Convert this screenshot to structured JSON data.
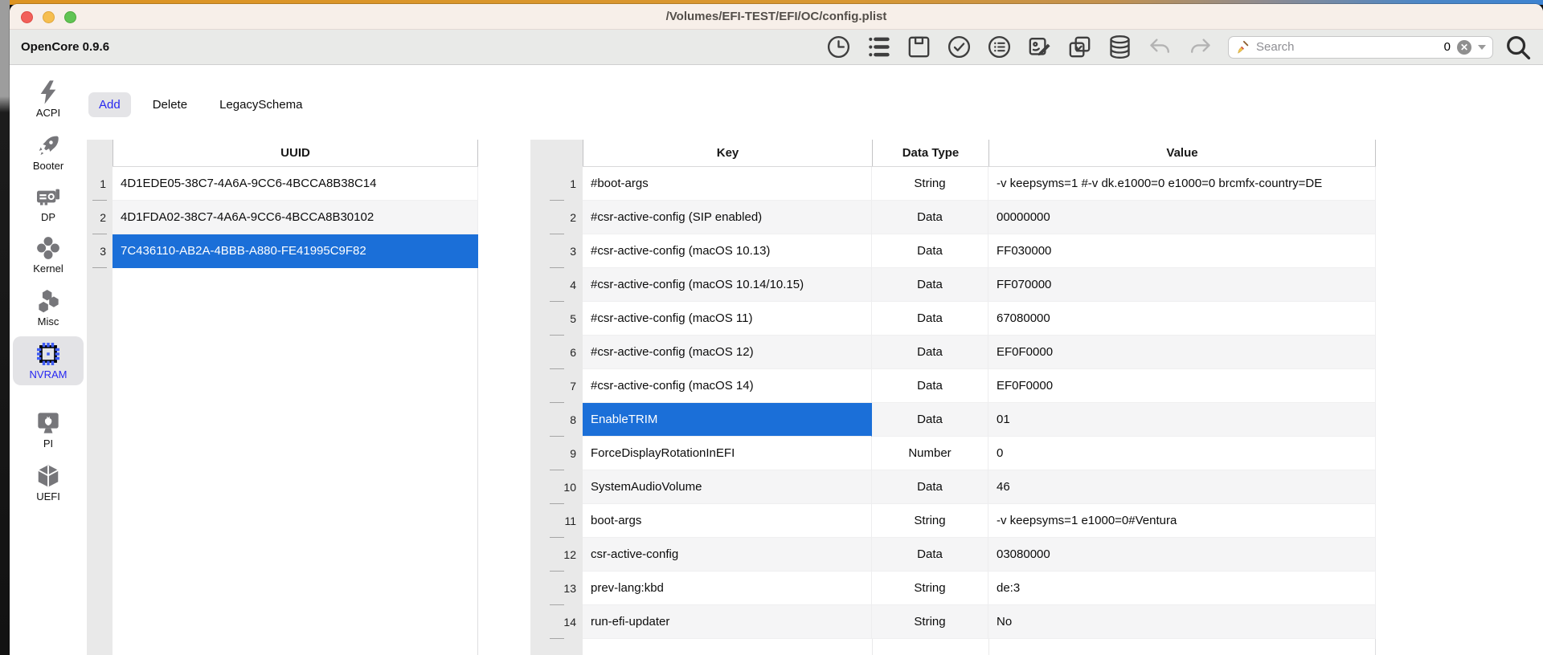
{
  "window": {
    "title": "/Volumes/EFI-TEST/EFI/OC/config.plist"
  },
  "toolbar": {
    "app_version": "OpenCore 0.9.6",
    "buttons": [
      {
        "name": "history",
        "disabled": false
      },
      {
        "name": "snapshot-list",
        "disabled": false
      },
      {
        "name": "save",
        "disabled": false
      },
      {
        "name": "validate",
        "disabled": false
      },
      {
        "name": "oc-info",
        "disabled": false
      },
      {
        "name": "edit-plist",
        "disabled": false
      },
      {
        "name": "sync",
        "disabled": false
      },
      {
        "name": "database",
        "disabled": false
      },
      {
        "name": "undo",
        "disabled": true
      },
      {
        "name": "redo",
        "disabled": true
      }
    ],
    "search": {
      "placeholder": "Search",
      "count": "0"
    }
  },
  "sidebar": {
    "items": [
      {
        "label": "ACPI",
        "icon": "bolt",
        "selected": false
      },
      {
        "label": "Booter",
        "icon": "rocket",
        "selected": false
      },
      {
        "label": "DP",
        "icon": "gpu",
        "selected": false
      },
      {
        "label": "Kernel",
        "icon": "kernel",
        "selected": false
      },
      {
        "label": "Misc",
        "icon": "misc",
        "selected": false
      },
      {
        "label": "NVRAM",
        "icon": "chip",
        "selected": true
      },
      {
        "label": "PI",
        "icon": "display",
        "selected": false
      },
      {
        "label": "UEFI",
        "icon": "cube",
        "selected": false
      }
    ]
  },
  "tabs": {
    "items": [
      {
        "label": "Add",
        "selected": true
      },
      {
        "label": "Delete",
        "selected": false
      },
      {
        "label": "LegacySchema",
        "selected": false
      }
    ]
  },
  "uuid_table": {
    "header": "UUID",
    "selected_row": 3,
    "rows": [
      {
        "num": "1",
        "uuid": "4D1EDE05-38C7-4A6A-9CC6-4BCCA8B38C14"
      },
      {
        "num": "2",
        "uuid": "4D1FDA02-38C7-4A6A-9CC6-4BCCA8B30102"
      },
      {
        "num": "3",
        "uuid": "7C436110-AB2A-4BBB-A880-FE41995C9F82"
      }
    ]
  },
  "kv_table": {
    "headers": {
      "key": "Key",
      "type": "Data Type",
      "value": "Value"
    },
    "selected_key_row": 8,
    "rows": [
      {
        "num": "1",
        "key": "#boot-args",
        "type": "String",
        "value": "-v keepsyms=1 #-v dk.e1000=0 e1000=0 brcmfx-country=DE"
      },
      {
        "num": "2",
        "key": "#csr-active-config (SIP enabled)",
        "type": "Data",
        "value": "00000000"
      },
      {
        "num": "3",
        "key": "#csr-active-config (macOS 10.13)",
        "type": "Data",
        "value": "FF030000"
      },
      {
        "num": "4",
        "key": "#csr-active-config (macOS 10.14/10.15)",
        "type": "Data",
        "value": "FF070000"
      },
      {
        "num": "5",
        "key": "#csr-active-config (macOS 11)",
        "type": "Data",
        "value": "67080000"
      },
      {
        "num": "6",
        "key": "#csr-active-config (macOS 12)",
        "type": "Data",
        "value": "EF0F0000"
      },
      {
        "num": "7",
        "key": "#csr-active-config (macOS 14)",
        "type": "Data",
        "value": "EF0F0000"
      },
      {
        "num": "8",
        "key": "EnableTRIM",
        "type": "Data",
        "value": "01"
      },
      {
        "num": "9",
        "key": "ForceDisplayRotationInEFI",
        "type": "Number",
        "value": "0"
      },
      {
        "num": "10",
        "key": "SystemAudioVolume",
        "type": "Data",
        "value": "46"
      },
      {
        "num": "11",
        "key": "boot-args",
        "type": "String",
        "value": "-v keepsyms=1 e1000=0#Ventura"
      },
      {
        "num": "12",
        "key": "csr-active-config",
        "type": "Data",
        "value": "03080000"
      },
      {
        "num": "13",
        "key": "prev-lang:kbd",
        "type": "String",
        "value": "de:3"
      },
      {
        "num": "14",
        "key": "run-efi-updater",
        "type": "String",
        "value": "No"
      }
    ]
  },
  "colors": {
    "selection_blue": "#1b6fd8",
    "accent_blue": "#2727f0",
    "strip_orange": "#dd9422",
    "strip_blue": "#3d83d1"
  }
}
